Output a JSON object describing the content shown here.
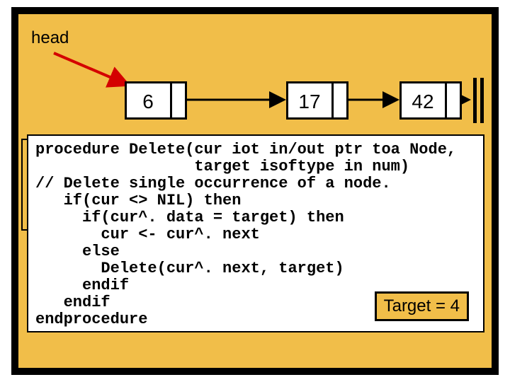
{
  "head_label": "head",
  "nodes": [
    {
      "value": "6"
    },
    {
      "value": "17"
    },
    {
      "value": "42"
    }
  ],
  "code_lines": [
    "procedure Delete(cur iot in/out ptr toa Node,",
    "                 target isoftype in num)",
    "// Delete single occurrence of a node.",
    "   if(cur <> NIL) then",
    "     if(cur^. data = target) then",
    "       cur <- cur^. next",
    "     else",
    "       Delete(cur^. next, target)",
    "     endif",
    "   endif",
    "endprocedure"
  ],
  "target_label": "Target = 4"
}
